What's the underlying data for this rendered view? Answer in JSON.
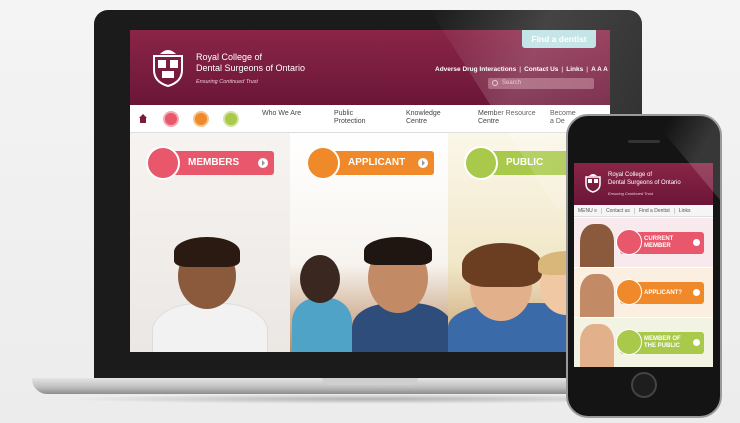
{
  "site": {
    "org_name_line1": "Royal College of",
    "org_name_line2": "Dental Surgeons of Ontario",
    "tagline": "Ensuring Continued Trust",
    "find_dentist": "Find a dentist",
    "top_links": [
      "Adverse Drug Interactions",
      "Contact Us",
      "Links",
      "A A A"
    ],
    "search_placeholder": "Search",
    "nav": [
      "Who We Are",
      "Public\nProtection",
      "Knowledge\nCentre",
      "Member Resource\nCentre",
      "Become\na De"
    ],
    "panels": [
      "MEMBERS",
      "APPLICANT",
      "PUBLIC"
    ]
  },
  "mobile": {
    "org_name_line1": "Royal College of",
    "org_name_line2": "Dental Surgeons of Ontario",
    "tagline": "Ensuring Continued Trust",
    "nav": [
      "MENU ≡",
      "Contact us",
      "Find a Dentist",
      "Links"
    ],
    "rows": [
      {
        "line1": "CURRENT",
        "line2": "MEMBER"
      },
      {
        "line1": "APPLICANT?",
        "line2": ""
      },
      {
        "line1": "MEMBER OF",
        "line2": "THE PUBLIC"
      }
    ]
  },
  "colors": {
    "brand": "#7a1a3d",
    "members": "#e8576b",
    "applicant": "#f0892a",
    "public": "#a8c94a"
  }
}
